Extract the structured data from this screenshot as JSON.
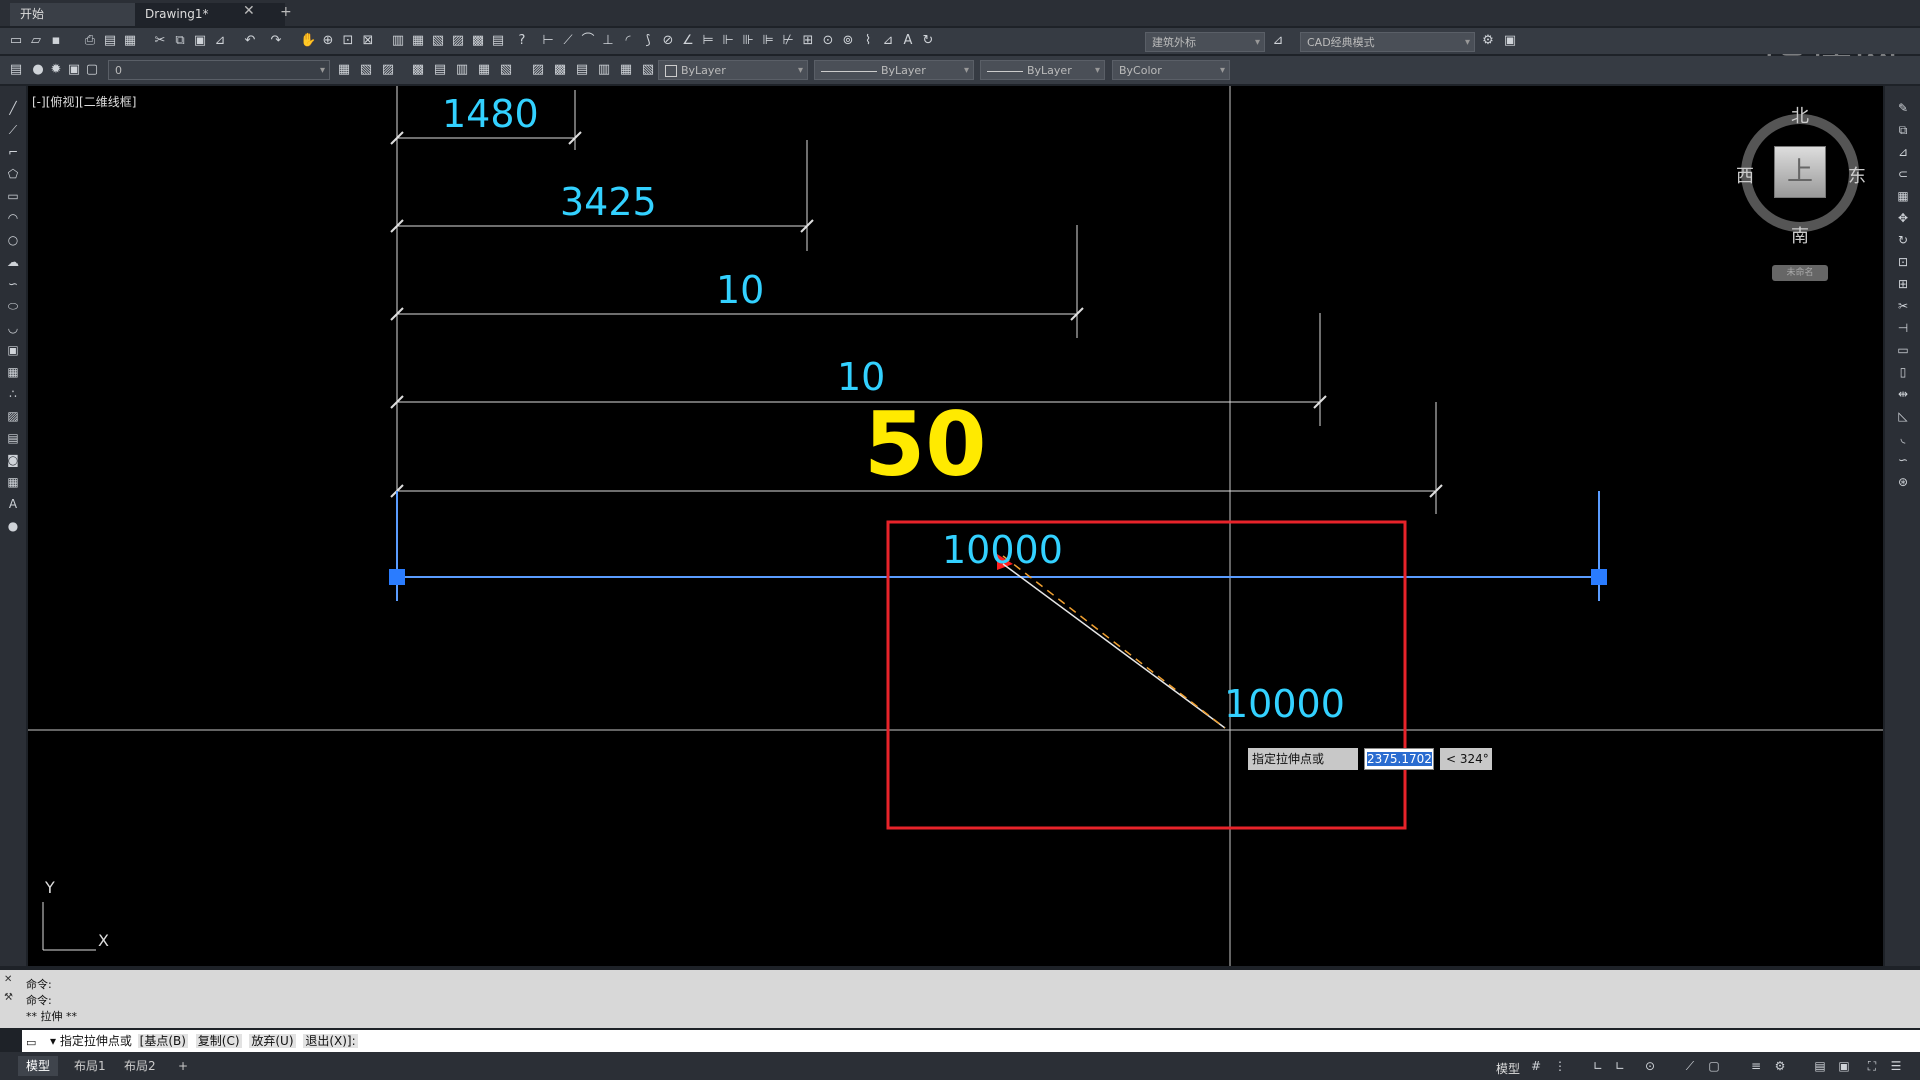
{
  "tabs": {
    "start": "开始",
    "drawing": "Drawing1*",
    "close": "✕",
    "add": "+"
  },
  "toolbar": {
    "workspace_anno": "建筑外标",
    "workspace_mode": "CAD经典模式",
    "layer_name": "0",
    "color": "ByLayer",
    "linetype": "ByLayer",
    "lineweight": "ByLayer",
    "plotstyle": "ByColor"
  },
  "watermark": "虎课网",
  "viewport_label": "[-][俯视][二维线框]",
  "viewcube": {
    "north": "北",
    "south": "南",
    "east": "东",
    "west": "西",
    "top": "上",
    "wcs": "未命名"
  },
  "dimensions": [
    {
      "text": "1480"
    },
    {
      "text": "3425"
    },
    {
      "text": "10"
    },
    {
      "text": "10"
    },
    {
      "text": "50"
    },
    {
      "text": "10000"
    },
    {
      "text": "10000"
    }
  ],
  "ucs": {
    "x": "X",
    "y": "Y"
  },
  "dynamic_input": {
    "prompt": "指定拉伸点或",
    "value": "2375.1702",
    "angle": "< 324°"
  },
  "command_history": [
    "命令:",
    "命令:",
    "** 拉伸 **"
  ],
  "command_line": {
    "prompt": "▾ 指定拉伸点或",
    "options": [
      "[基点(B)",
      "复制(C)",
      "放弃(U)",
      "退出(X)]:"
    ]
  },
  "layout_tabs": [
    "模型",
    "布局1",
    "布局2",
    "+"
  ],
  "status": {
    "model": "模型"
  }
}
